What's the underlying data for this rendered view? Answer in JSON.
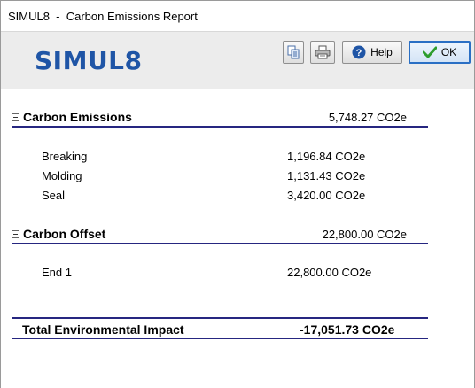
{
  "window": {
    "title": "SIMUL8  -  Carbon Emissions Report"
  },
  "header": {
    "logo_text": "SIMUL8",
    "buttons": {
      "copy_icon": "copy-icon",
      "print_icon": "printer-icon",
      "help_label": "Help",
      "ok_label": "OK"
    }
  },
  "sections": [
    {
      "label": "Carbon Emissions",
      "total": "5,748.27 CO2e",
      "items": [
        {
          "name": "Breaking",
          "value": "1,196.84 CO2e"
        },
        {
          "name": "Molding",
          "value": "1,131.43 CO2e"
        },
        {
          "name": "Seal",
          "value": "3,420.00 CO2e"
        }
      ]
    },
    {
      "label": "Carbon Offset",
      "total": "22,800.00 CO2e",
      "items": [
        {
          "name": "End 1",
          "value": "22,800.00 CO2e"
        }
      ]
    }
  ],
  "summary": {
    "label": "Total Environmental Impact",
    "value": "-17,051.73 CO2e"
  },
  "colors": {
    "logo": "#1f55a6",
    "rule": "#262680",
    "ok_border": "#2a6fc4",
    "help_icon": "#1f55a6",
    "ok_check": "#2e9d2e"
  }
}
